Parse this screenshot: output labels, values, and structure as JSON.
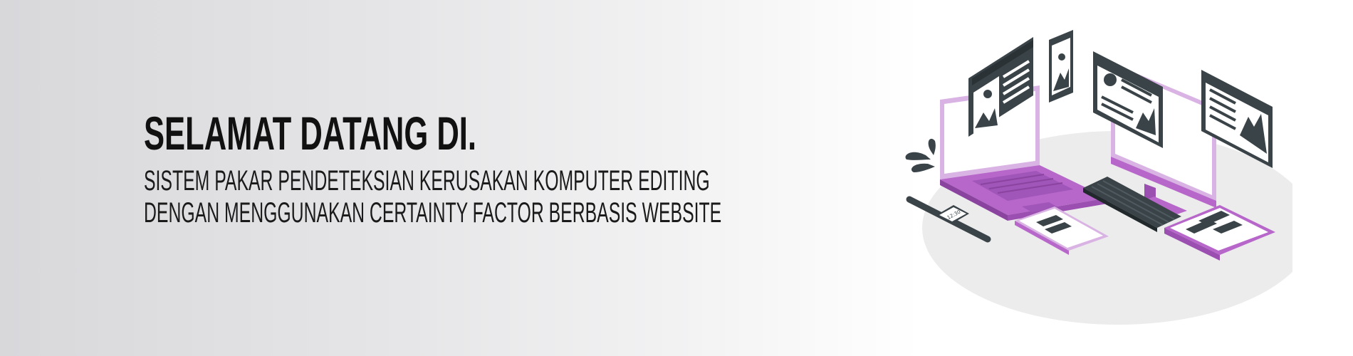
{
  "banner": {
    "headline": "SELAMAT DATANG DI.",
    "subtitle_line1": "SISTEM PAKAR PENDETEKSIAN KERUSAKAN KOMPUTER EDITING",
    "subtitle_line2": "DENGAN MENGGUNAKAN CERTAINTY FACTOR BERBASIS WEBSITE"
  },
  "illustration": {
    "smartwatch_time": "12:30",
    "colors": {
      "accent_purple": "#b766c9",
      "purple_dark": "#9b4fb0",
      "purple_light": "#d9b3e3",
      "slate": "#3a4348",
      "platform": "#ececec"
    },
    "icons": [
      "laptop-icon",
      "monitor-icon",
      "keyboard-icon",
      "tablet-icon",
      "smartwatch-icon",
      "phone-icon",
      "plant-icon",
      "image-window-icon",
      "profile-card-icon"
    ]
  }
}
